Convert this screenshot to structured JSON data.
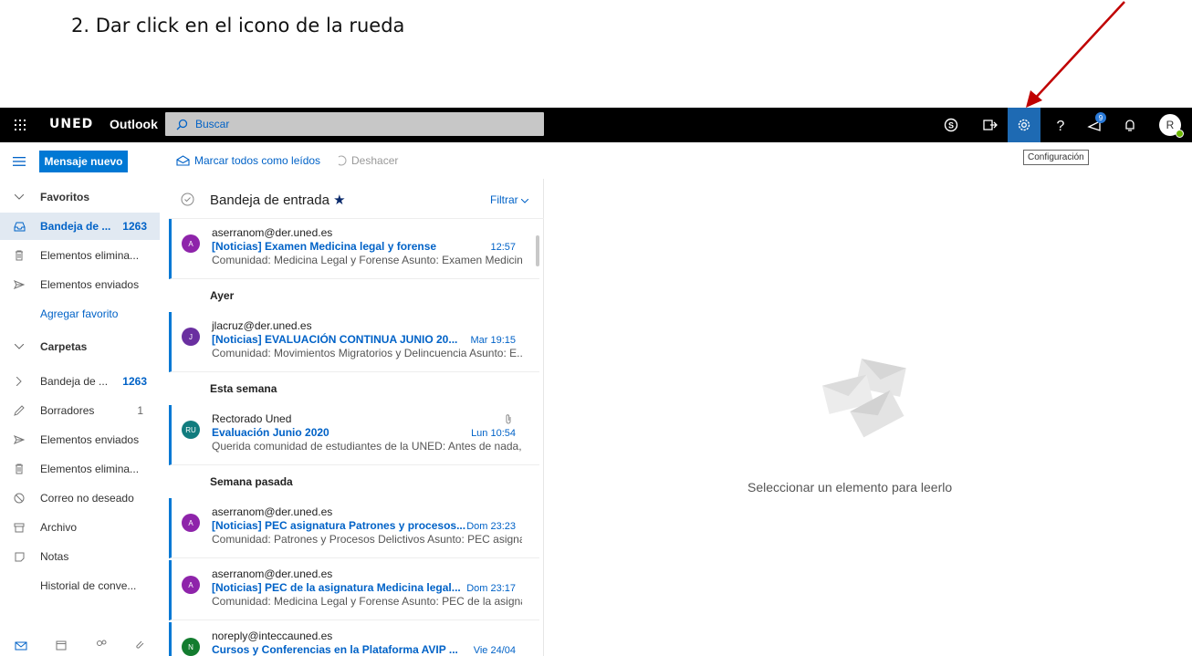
{
  "instruction": "2. Dar click en el icono de la rueda",
  "topbar": {
    "brand": "UNED",
    "app_name": "Outlook",
    "search_placeholder": "Buscar",
    "notification_badge": "9",
    "user_initial": "R"
  },
  "commandbar": {
    "new_message": "Mensaje nuevo",
    "mark_all_read": "Marcar todos como leídos",
    "undo": "Deshacer",
    "tooltip": "Configuración"
  },
  "sidebar": {
    "favorites_header": "Favoritos",
    "favorites": [
      {
        "label": "Bandeja de ...",
        "count": "1263"
      },
      {
        "label": "Elementos elimina..."
      },
      {
        "label": "Elementos enviados"
      }
    ],
    "add_favorite": "Agregar favorito",
    "folders_header": "Carpetas",
    "folders": [
      {
        "label": "Bandeja de ...",
        "count": "1263"
      },
      {
        "label": "Borradores",
        "count": "1"
      },
      {
        "label": "Elementos enviados"
      },
      {
        "label": "Elementos elimina..."
      },
      {
        "label": "Correo no deseado"
      },
      {
        "label": "Archivo"
      },
      {
        "label": "Notas"
      },
      {
        "label": "Historial de conve..."
      }
    ]
  },
  "list": {
    "title": "Bandeja de entrada",
    "filter": "Filtrar",
    "groups": [
      "Ayer",
      "Esta semana",
      "Semana pasada"
    ],
    "messages": [
      {
        "initials": "A",
        "color": "#8e24aa",
        "from": "aserranom@der.uned.es",
        "subject": "[Noticias] Examen Medicina legal y forense",
        "time": "12:57",
        "preview": "Comunidad: Medicina Legal y Forense Asunto: Examen Medicin..."
      },
      {
        "initials": "J",
        "color": "#6a2fa0",
        "from": "jlacruz@der.uned.es",
        "subject": "[Noticias] EVALUACIÓN CONTINUA JUNIO 20...",
        "time": "Mar 19:15",
        "preview": "Comunidad: Movimientos Migratorios y Delincuencia Asunto: E..."
      },
      {
        "initials": "RU",
        "color": "#117c7e",
        "from": "Rectorado Uned",
        "subject": "Evaluación Junio 2020",
        "time": "Lun 10:54",
        "preview": "Querida comunidad de estudiantes de la UNED: Antes de nada,..."
      },
      {
        "initials": "A",
        "color": "#8e24aa",
        "from": "aserranom@der.uned.es",
        "subject": "[Noticias] PEC asignatura Patrones y procesos...",
        "time": "Dom 23:23",
        "preview": "Comunidad: Patrones y Procesos Delictivos Asunto: PEC asigna..."
      },
      {
        "initials": "A",
        "color": "#8e24aa",
        "from": "aserranom@der.uned.es",
        "subject": "[Noticias] PEC de la asignatura Medicina legal...",
        "time": "Dom 23:17",
        "preview": "Comunidad: Medicina Legal y Forense Asunto: PEC de la asigna..."
      },
      {
        "initials": "N",
        "color": "#137c2f",
        "from": "noreply@inteccauned.es",
        "subject": "Cursos y Conferencias en la Plataforma AVIP ...",
        "time": "Vie 24/04",
        "preview": ""
      }
    ]
  },
  "reading": {
    "empty_text": "Seleccionar un elemento para leerlo"
  }
}
